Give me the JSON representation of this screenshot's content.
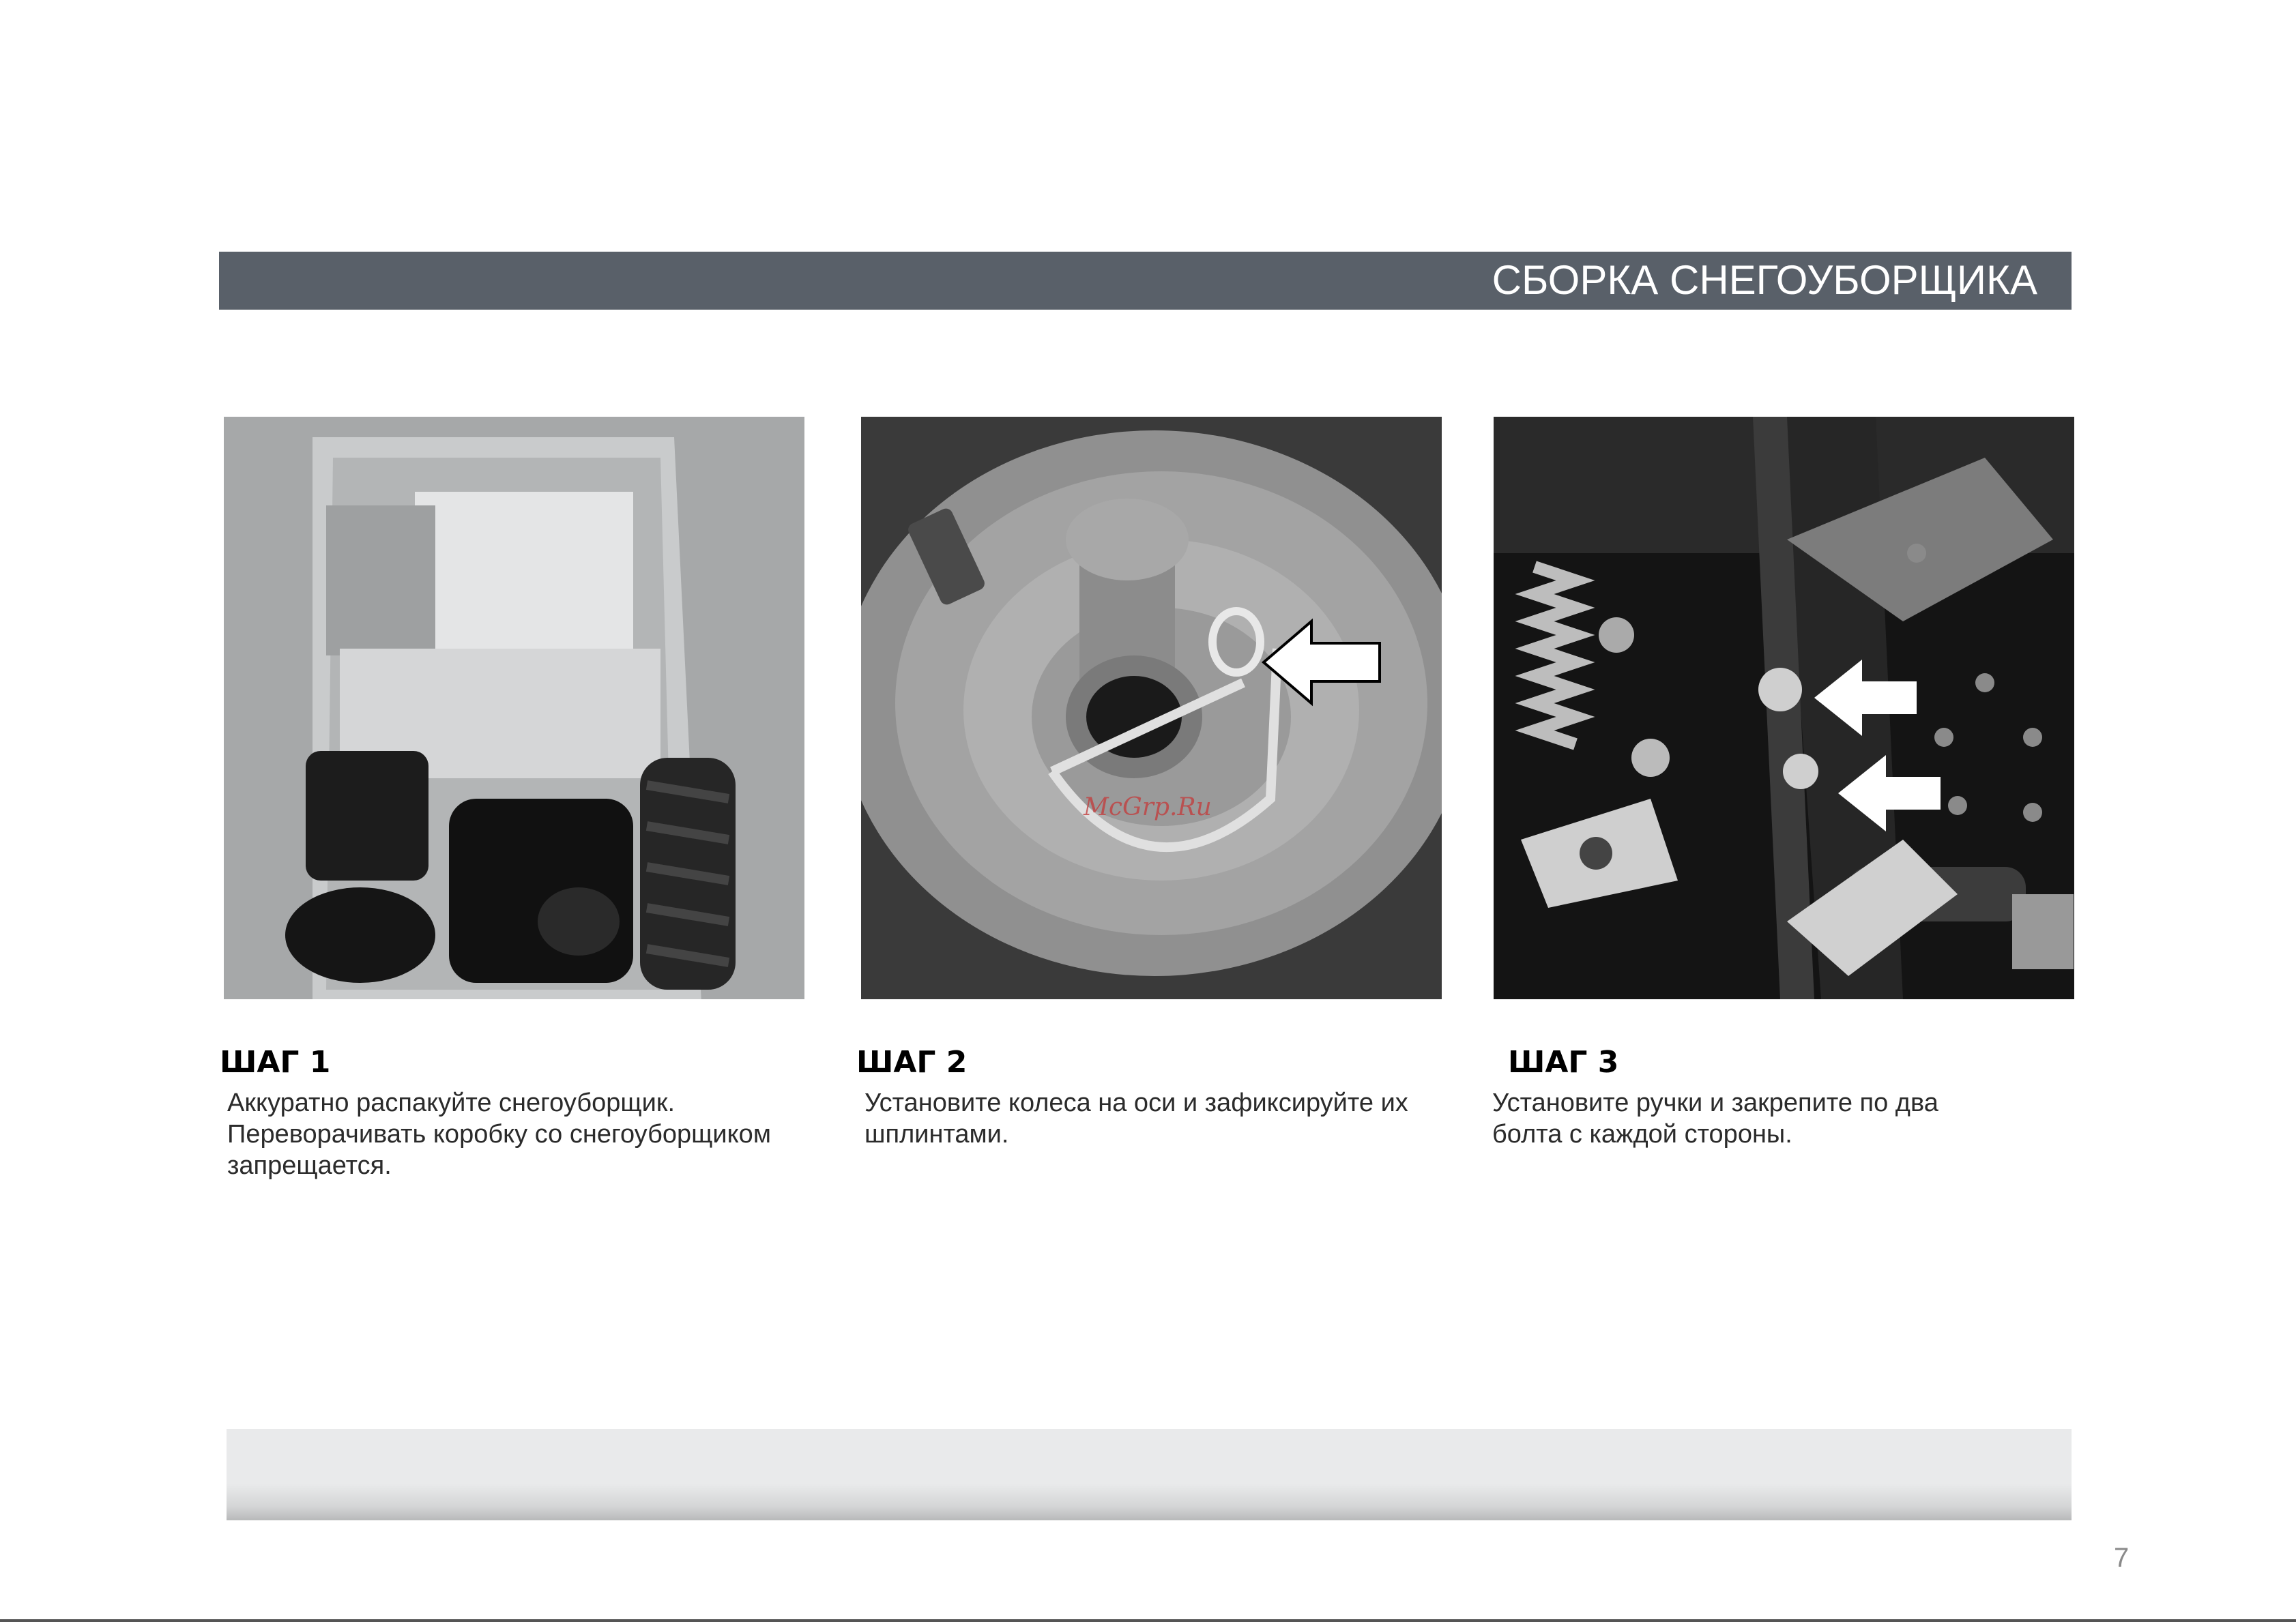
{
  "header": {
    "title": "СБОРКА СНЕГОУБОРЩИКА"
  },
  "steps": [
    {
      "title": "ШАГ 1",
      "lines": [
        "Аккуратно распакуйте снегоуборщик.",
        "Переворачивать коробку со снегоуборщиком",
        "запрещается."
      ]
    },
    {
      "title": "ШАГ 2",
      "lines": [
        "Установите колеса на оси и зафиксируйте их",
        "шплинтами."
      ]
    },
    {
      "title": "ШАГ 3",
      "lines": [
        "Установите ручки и закрепите по два",
        "болта с каждой стороны."
      ]
    }
  ],
  "watermark": "McGrp.Ru",
  "page_number": "7",
  "colors": {
    "header_bar": "#596069",
    "footer_band": "#e9eaeb"
  }
}
